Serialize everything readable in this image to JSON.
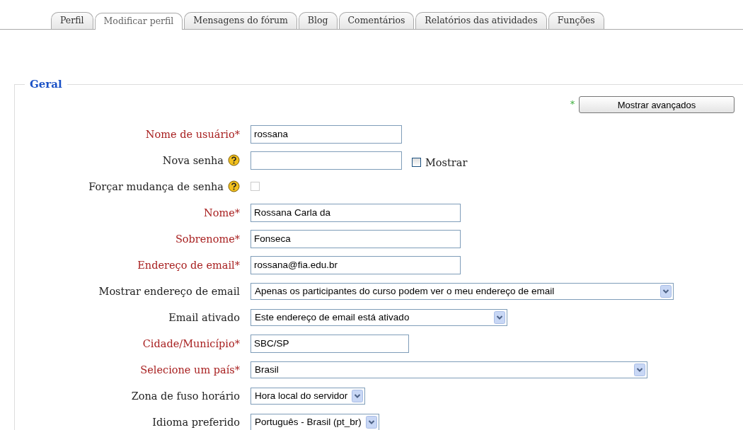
{
  "tabs": [
    {
      "label": "Perfil",
      "selected": false
    },
    {
      "label": "Modificar perfil",
      "selected": true
    },
    {
      "label": "Mensagens do fórum",
      "selected": false
    },
    {
      "label": "Blog",
      "selected": false
    },
    {
      "label": "Comentários",
      "selected": false
    },
    {
      "label": "Relatórios das atividades",
      "selected": false
    },
    {
      "label": "Funções",
      "selected": false
    }
  ],
  "section": {
    "legend": "Geral",
    "advanced_marker": "*",
    "advanced_button": "Mostrar avançados"
  },
  "fields": [
    {
      "kind": "text",
      "label": "Nome de usuário*",
      "required": true,
      "value": "rossana"
    },
    {
      "kind": "password",
      "label": "Nova senha",
      "required": false,
      "help": true,
      "show_label": "Mostrar",
      "show_checked": false
    },
    {
      "kind": "checkbox",
      "label": "Forçar mudança de senha",
      "required": false,
      "help": true,
      "checked": false,
      "disabled": true
    },
    {
      "kind": "text",
      "label": "Nome*",
      "required": true,
      "value": "Rossana Carla da"
    },
    {
      "kind": "text",
      "label": "Sobrenome*",
      "required": true,
      "value": "Fonseca"
    },
    {
      "kind": "text",
      "label": "Endereço de email*",
      "required": true,
      "value": "rossana@fia.edu.br"
    },
    {
      "kind": "select",
      "label": "Mostrar endereço de email",
      "required": false,
      "value": "Apenas os participantes do curso podem ver o meu endereço de email"
    },
    {
      "kind": "select",
      "label": "Email ativado",
      "required": false,
      "value": "Este endereço de email está ativado"
    },
    {
      "kind": "text",
      "label": "Cidade/Município*",
      "required": true,
      "value": "SBC/SP"
    },
    {
      "kind": "select",
      "label": "Selecione um país*",
      "required": true,
      "value": "Brasil"
    },
    {
      "kind": "select",
      "label": "Zona de fuso horário",
      "required": false,
      "value": "Hora local do servidor"
    },
    {
      "kind": "select",
      "label": "Idioma preferido",
      "required": false,
      "value": "Português - Brasil (pt_br)"
    }
  ]
}
